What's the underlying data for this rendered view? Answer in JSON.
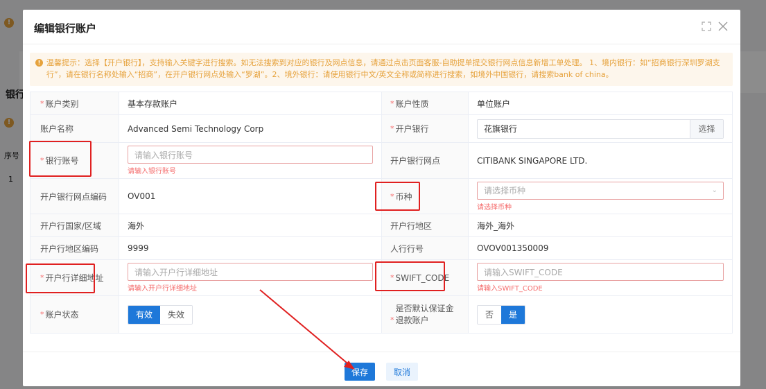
{
  "background": {
    "side_label": "银行",
    "col_label": "序号",
    "row_index": "1"
  },
  "modal": {
    "title": "编辑银行账户",
    "tip": "温馨提示：选择【开户银行】，支持输入关键字进行搜索。如无法搜索到对应的银行及网点信息，请通过点击页面客服-自助提单提交银行网点信息新增工单处理。 1、境内银行：如“招商银行深圳罗湖支行”，请在银行名称处输入“招商”，在开户银行网点处输入“罗湖”。2、境外银行：请使用银行中文/英文全称或简称进行搜索，如境外中国银行，请搜索bank of china。",
    "fields": {
      "account_type_label": "账户类别",
      "account_type_value": "基本存款账户",
      "account_nature_label": "账户性质",
      "account_nature_value": "单位账户",
      "account_name_label": "账户名称",
      "account_name_value": "Advanced Semi Technology Corp",
      "open_bank_label": "开户银行",
      "open_bank_value": "花旗银行",
      "open_bank_select": "选择",
      "bank_account_label": "银行账号",
      "bank_account_placeholder": "请输入银行账号",
      "bank_account_error": "请输入银行账号",
      "branch_label": "开户银行网点",
      "branch_value": "CITIBANK SINGAPORE LTD.",
      "branch_code_label": "开户银行网点编码",
      "branch_code_value": "OV001",
      "currency_label": "币种",
      "currency_placeholder": "请选择币种",
      "currency_error": "请选择币种",
      "country_label": "开户行国家/区域",
      "country_value": "海外",
      "region_label": "开户行地区",
      "region_value": "海外_海外",
      "region_code_label": "开户行地区编码",
      "region_code_value": "9999",
      "pboc_label": "人行行号",
      "pboc_value": "OVOV001350009",
      "address_label": "开户行详细地址",
      "address_placeholder": "请输入开户行详细地址",
      "address_error": "请输入开户行详细地址",
      "swift_label": "SWIFT_CODE",
      "swift_placeholder": "请输入SWIFT_CODE",
      "swift_error": "请输入SWIFT_CODE",
      "status_label": "账户状态",
      "status_on": "有效",
      "status_off": "失效",
      "default_refund_label": "是否默认保证金退款账户",
      "default_no": "否",
      "default_yes": "是"
    },
    "footer": {
      "save": "保存",
      "cancel": "取消"
    }
  },
  "colors": {
    "primary": "#1e78d9",
    "error": "#f56c6c",
    "warning": "#e6a23c",
    "highlight": "#e02020"
  }
}
